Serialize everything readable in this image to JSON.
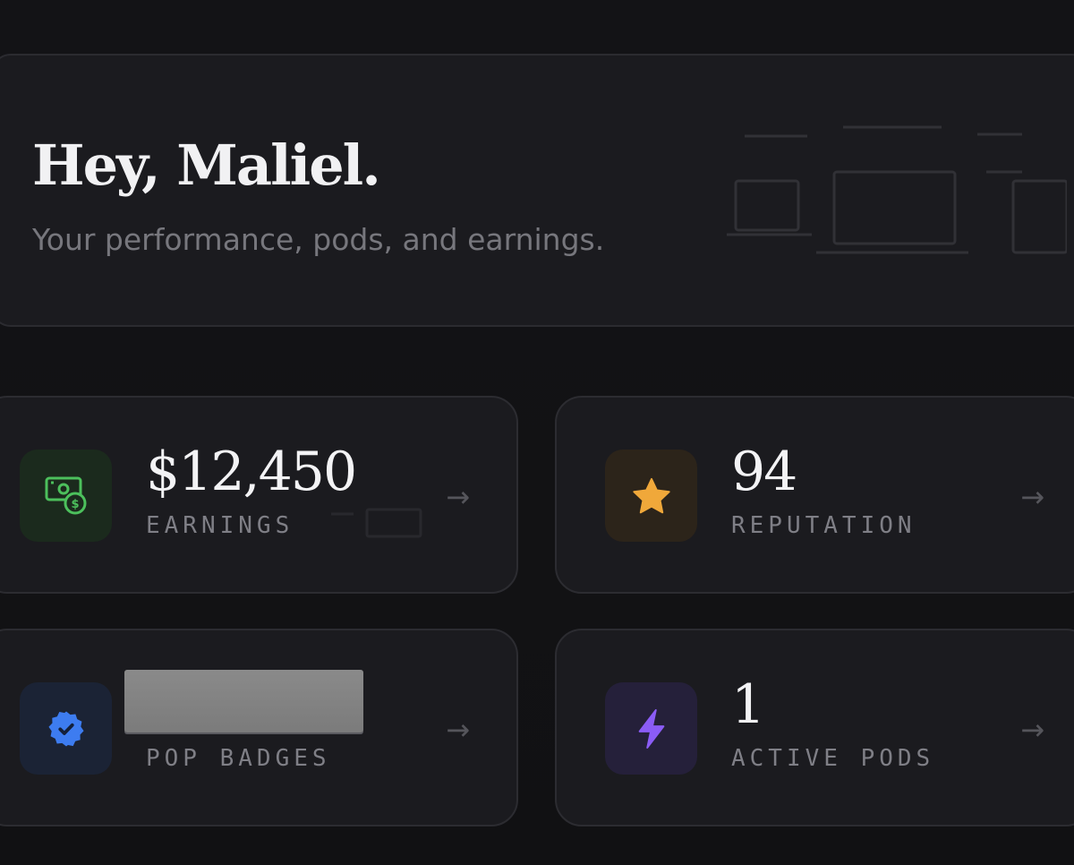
{
  "hero": {
    "greeting": "Hey, Maliel.",
    "subtitle": "Your performance, pods, and earnings."
  },
  "stats": [
    {
      "value": "$12,450",
      "label": "EARNINGS",
      "icon": "cash-icon",
      "accent": "#4cc05c"
    },
    {
      "value": "94",
      "label": "REPUTATION",
      "icon": "star-icon",
      "accent": "#f0a83a"
    },
    {
      "value": "",
      "label": "POP BADGES",
      "icon": "verified-badge-icon",
      "accent": "#3d7cf0"
    },
    {
      "value": "1",
      "label": "ACTIVE PODS",
      "icon": "lightning-icon",
      "accent": "#8b5cf6"
    }
  ],
  "arrow_glyph": "→"
}
